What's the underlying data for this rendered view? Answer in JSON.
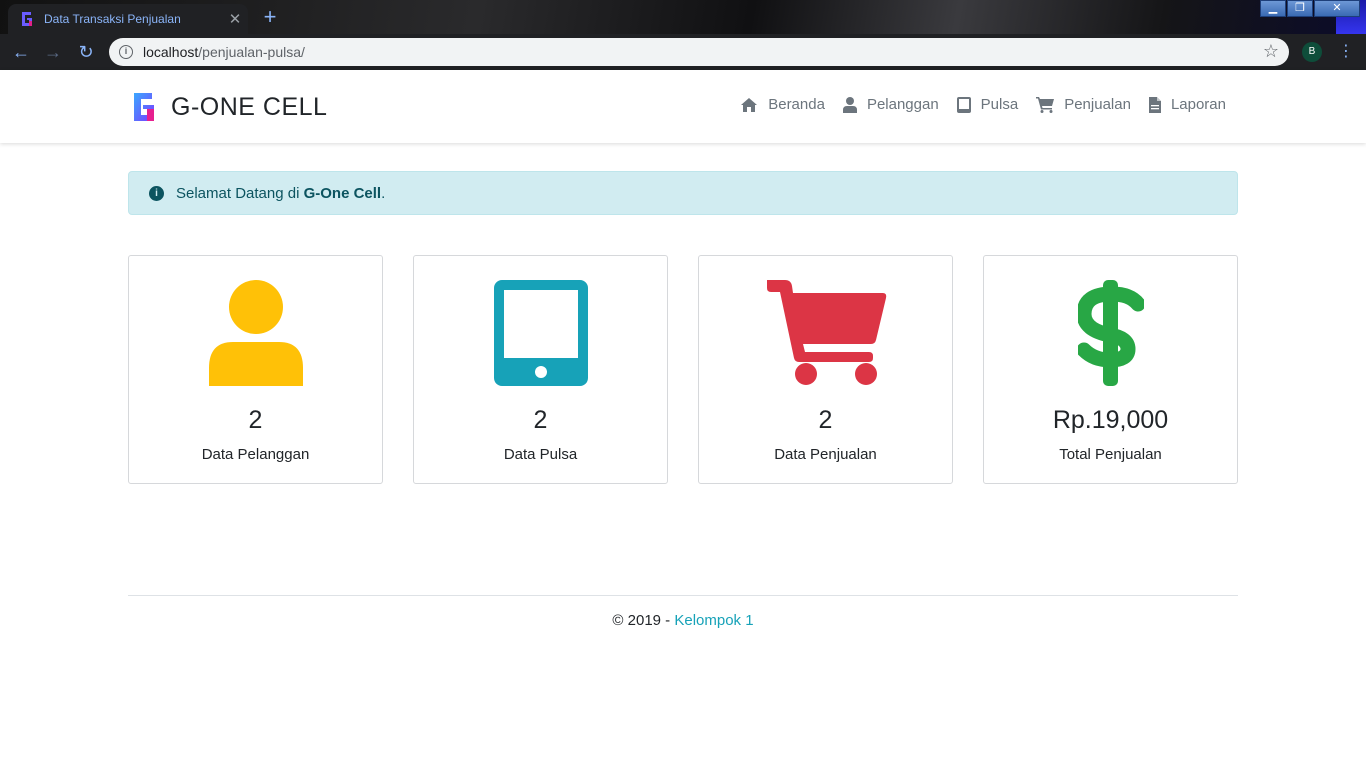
{
  "browser": {
    "tab_title": "Data Transaksi Penjualan",
    "url_host": "localhost",
    "url_path": "/penjualan-pulsa/",
    "profile_initial": "B"
  },
  "navbar": {
    "brand": "G-ONE CELL",
    "menu": [
      {
        "label": "Beranda",
        "icon": "home-icon"
      },
      {
        "label": "Pelanggan",
        "icon": "user-icon"
      },
      {
        "label": "Pulsa",
        "icon": "tablet-icon"
      },
      {
        "label": "Penjualan",
        "icon": "cart-icon"
      },
      {
        "label": "Laporan",
        "icon": "file-icon"
      }
    ]
  },
  "alert": {
    "prefix": "Selamat Datang di ",
    "bold": "G-One Cell",
    "suffix": "."
  },
  "cards": [
    {
      "value": "2",
      "label": "Data Pelanggan",
      "icon": "user-icon",
      "color": "#ffc107"
    },
    {
      "value": "2",
      "label": "Data Pulsa",
      "icon": "tablet-icon",
      "color": "#17a2b8"
    },
    {
      "value": "2",
      "label": "Data Penjualan",
      "icon": "cart-icon",
      "color": "#dc3545"
    },
    {
      "value": "Rp.19,000",
      "label": "Total Penjualan",
      "icon": "dollar-icon",
      "color": "#28a745"
    }
  ],
  "footer": {
    "text": "© 2019 - ",
    "link": "Kelompok 1"
  }
}
